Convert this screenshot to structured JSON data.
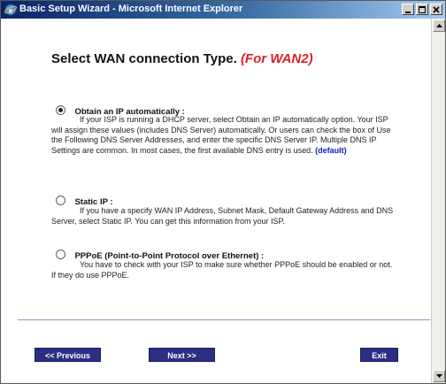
{
  "window": {
    "title": "Basic Setup Wizard - Microsoft Internet Explorer"
  },
  "page": {
    "heading": "Select WAN connection Type.",
    "heading_accent": "(For WAN2)",
    "options": [
      {
        "label": "Obtain an IP automatically :",
        "selected": true,
        "description": "If your ISP is running a DHCP server, select Obtain an IP automatically option. Your ISP will assign these values (includes DNS Server) automatically. Or users can check the box of Use the Following DNS Server Addresses, and enter the specific DNS Server IP. Multiple DNS IP Settings are common. In most cases, the first available DNS entry is used.",
        "default_tag": "(default)"
      },
      {
        "label": "Static IP :",
        "selected": false,
        "description": "If you have a specify WAN IP Address, Subnet Mask, Default Gateway Address and DNS Server, select Static IP. You can get this information from your ISP."
      },
      {
        "label": "PPPoE (Point-to-Point Protocol over Ethernet) :",
        "selected": false,
        "description": "You have to check with your ISP to make sure whether PPPoE should be enabled or not. If they do use PPPoE."
      }
    ]
  },
  "buttons": {
    "previous": "<< Previous",
    "next": "Next >>",
    "exit": "Exit"
  },
  "colors": {
    "accent": "#e02020",
    "button_bg": "#2a2f84",
    "default_tag": "#1020c0"
  },
  "icons": {
    "app": "internet-explorer-icon",
    "minimize": "minimize-icon",
    "maximize": "maximize-icon",
    "close": "close-icon"
  }
}
